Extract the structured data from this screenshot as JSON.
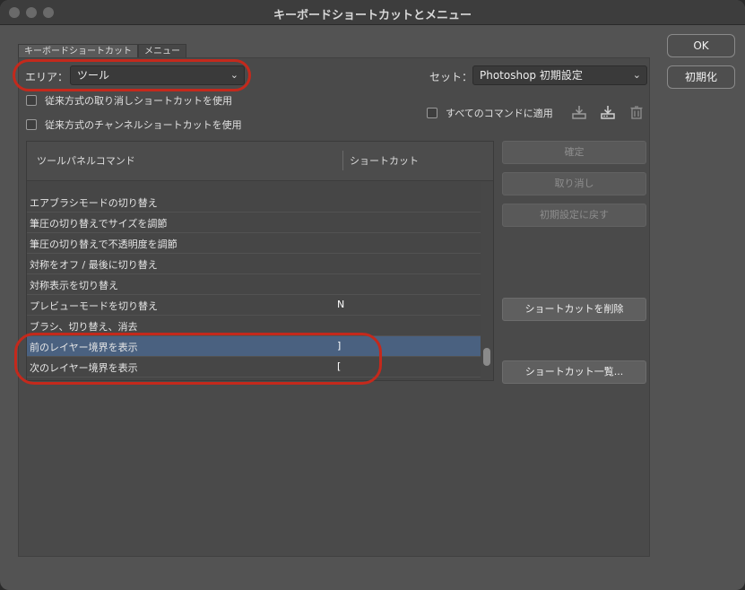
{
  "window": {
    "title": "キーボードショートカットとメニュー"
  },
  "tabs": [
    {
      "label": "キーボードショートカット",
      "active": true
    },
    {
      "label": "メニュー",
      "active": false
    }
  ],
  "area": {
    "label": "エリア：",
    "value": "ツール"
  },
  "set": {
    "label": "セット：",
    "value": "Photoshop 初期設定"
  },
  "options": {
    "legacy_undo": {
      "label": "従来方式の取り消しショートカットを使用",
      "checked": false
    },
    "legacy_channel": {
      "label": "従来方式のチャンネルショートカットを使用",
      "checked": false
    },
    "apply_all": {
      "label": "すべてのコマンドに適用",
      "checked": false
    }
  },
  "icons": {
    "save_set": "save-set-icon",
    "new_set": "new-set-icon",
    "delete_set": "trash-icon"
  },
  "table": {
    "col_command": "ツールパネルコマンド",
    "col_shortcut": "ショートカット",
    "rows": [
      {
        "command": "エアブラシモードの切り替え",
        "shortcut": ""
      },
      {
        "command": "筆圧の切り替えでサイズを調節",
        "shortcut": ""
      },
      {
        "command": "筆圧の切り替えで不透明度を調節",
        "shortcut": ""
      },
      {
        "command": "対称をオフ / 最後に切り替え",
        "shortcut": ""
      },
      {
        "command": "対称表示を切り替え",
        "shortcut": ""
      },
      {
        "command": "プレビューモードを切り替え",
        "shortcut": "N"
      },
      {
        "command": "ブラシ、切り替え、消去",
        "shortcut": ""
      },
      {
        "command": "前のレイヤー境界を表示",
        "shortcut": "]",
        "selected": true
      },
      {
        "command": "次のレイヤー境界を表示",
        "shortcut": "["
      }
    ]
  },
  "buttons": {
    "ok": "OK",
    "reset": "初期化",
    "accept": "確定",
    "undo": "取り消し",
    "use_default": "初期設定に戻す",
    "delete_shortcut": "ショートカットを削除",
    "summarize": "ショートカット一覧..."
  },
  "colors": {
    "selection": "#4a6180",
    "annotation": "#c4291c"
  }
}
